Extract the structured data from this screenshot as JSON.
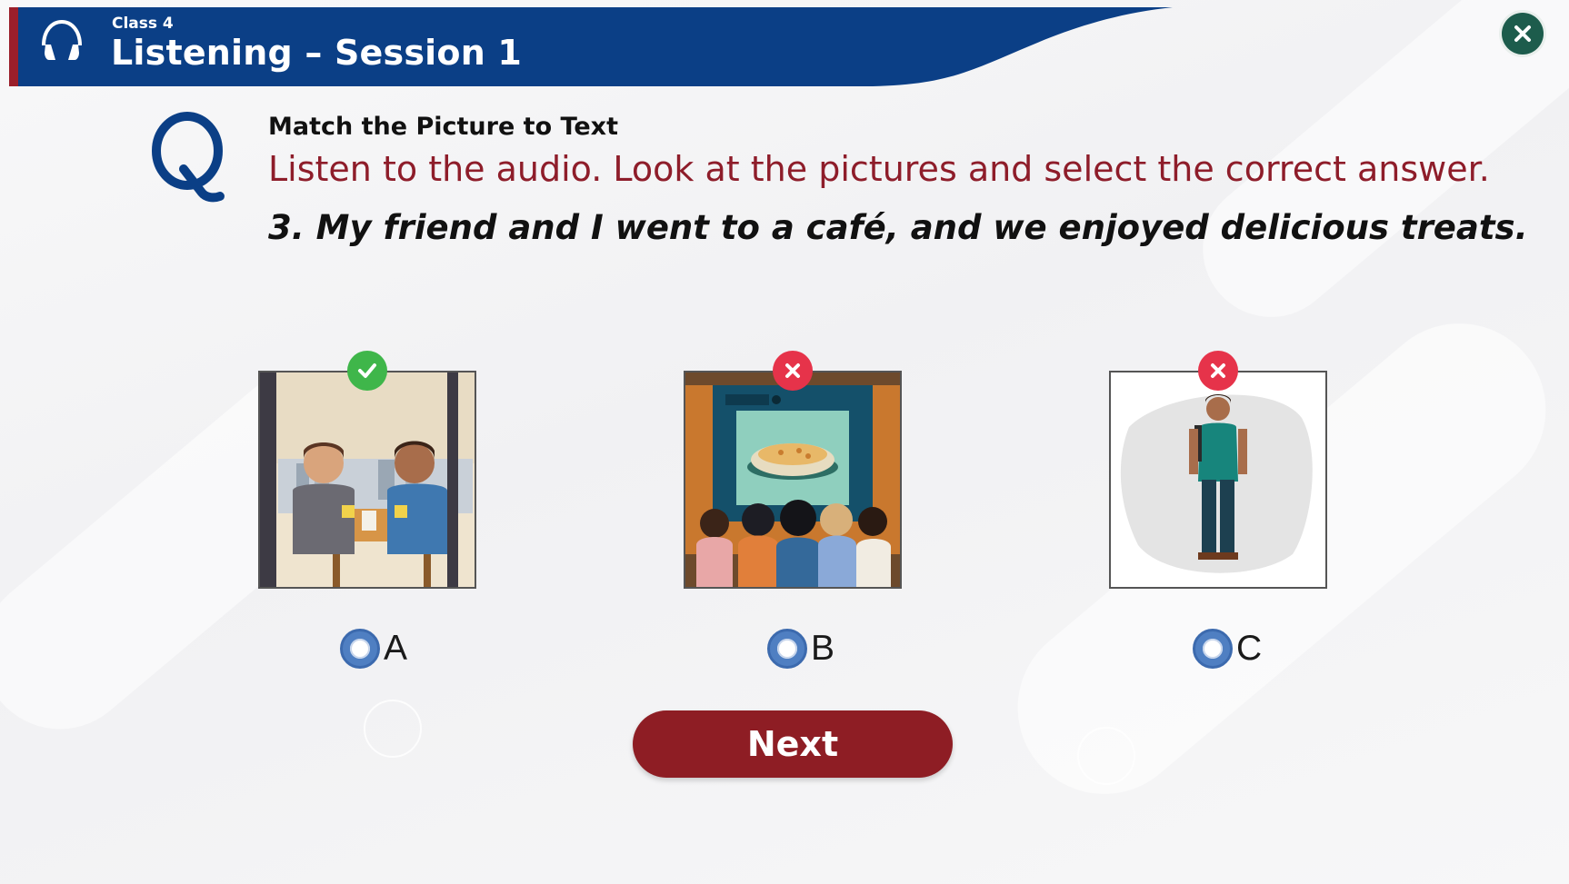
{
  "header": {
    "class_label": "Class 4",
    "title": "Listening – Session 1",
    "icon": "headphones-icon",
    "close_icon": "close-icon",
    "colors": {
      "bar": "#0b3f86",
      "strip": "#9b1f2b",
      "close": "#1d5c4c"
    }
  },
  "question": {
    "icon": "q-icon",
    "heading": "Match the Picture to Text",
    "instruction": "Listen to the audio. Look at the pictures and select the correct answer.",
    "sentence": "3. My friend and I went to a café, and we enjoyed delicious treats."
  },
  "options": [
    {
      "label": "A",
      "image": "two boys at a café table with drinks",
      "status": "correct",
      "status_icon": "check-icon"
    },
    {
      "label": "B",
      "image": "audience watching a screen showing food",
      "status": "wrong",
      "status_icon": "cross-icon"
    },
    {
      "label": "C",
      "image": "boy standing with a backpack",
      "status": "wrong",
      "status_icon": "cross-icon"
    }
  ],
  "next_button": {
    "label": "Next",
    "color": "#8e1d24"
  },
  "colors": {
    "correct": "#3fb64a",
    "wrong": "#e6334a",
    "radio": "#4f7fc2",
    "instruction": "#8e1d2a"
  }
}
